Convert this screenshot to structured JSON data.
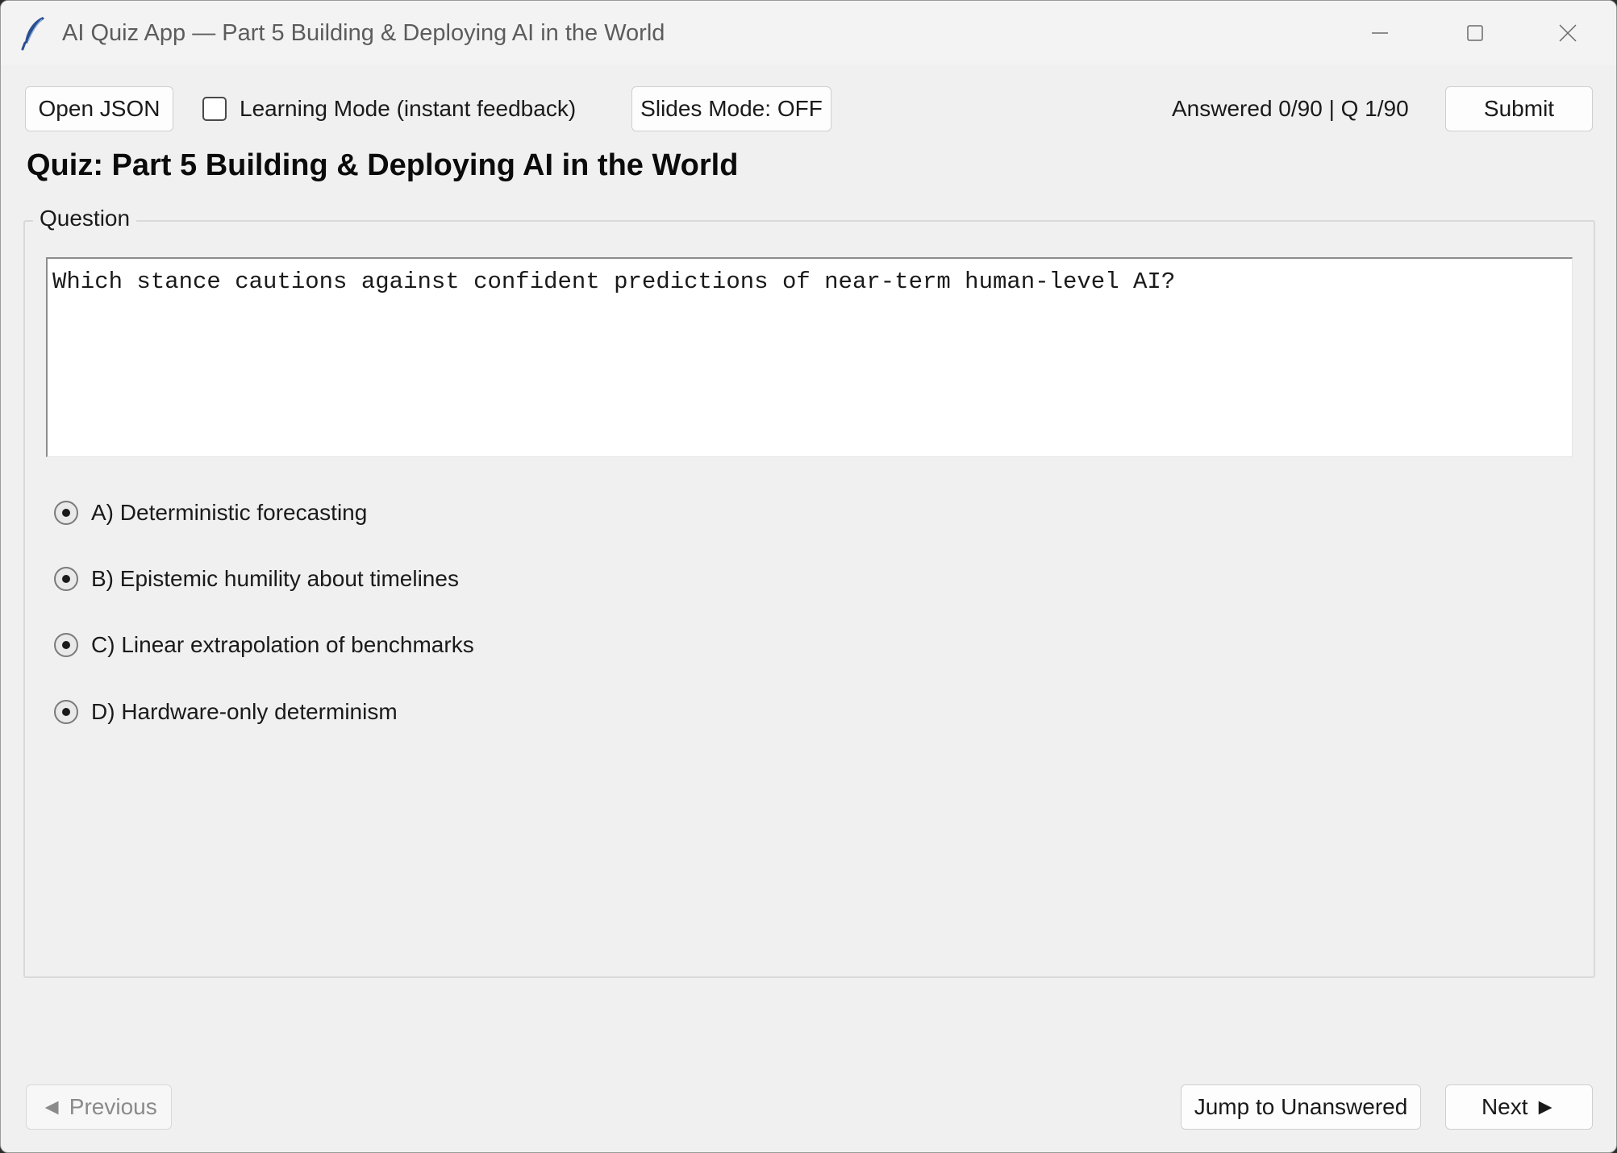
{
  "window": {
    "title": "AI Quiz App — Part 5 Building & Deploying AI in the World",
    "icon": "feather-icon"
  },
  "toolbar": {
    "open_json_label": "Open JSON",
    "learning_mode_label": "Learning Mode (instant feedback)",
    "learning_mode_checked": false,
    "slides_mode_label": "Slides Mode: OFF",
    "status_text": "Answered 0/90 | Q 1/90",
    "submit_label": "Submit"
  },
  "quiz": {
    "title": "Quiz: Part 5 Building & Deploying AI in the World",
    "question_legend": "Question",
    "question_text": "Which stance cautions against confident predictions of near-term human-level AI?",
    "options": [
      {
        "label": "A) Deterministic forecasting"
      },
      {
        "label": "B) Epistemic humility about timelines"
      },
      {
        "label": "C) Linear extrapolation of benchmarks"
      },
      {
        "label": "D) Hardware-only determinism"
      }
    ]
  },
  "footer": {
    "previous_label": "◄ Previous",
    "jump_label": "Jump to Unanswered",
    "next_label": "Next ►"
  }
}
